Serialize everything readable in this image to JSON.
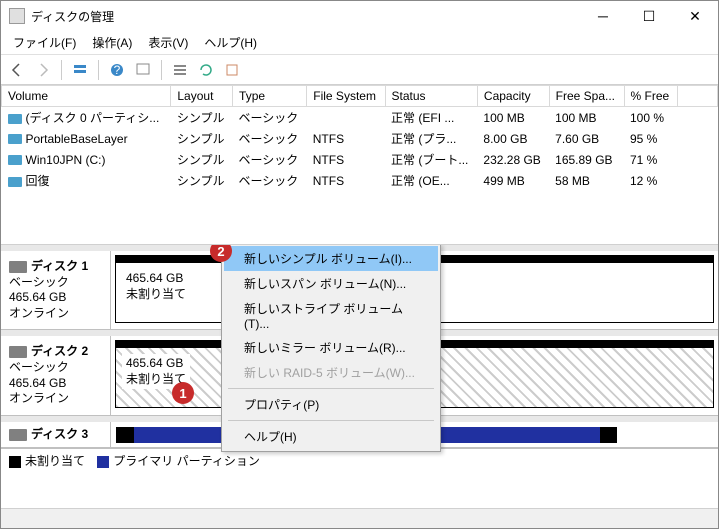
{
  "title": "ディスクの管理",
  "menu": {
    "file": "ファイル(F)",
    "action": "操作(A)",
    "view": "表示(V)",
    "help": "ヘルプ(H)"
  },
  "columns": {
    "vol": "Volume",
    "layout": "Layout",
    "type": "Type",
    "fs": "File System",
    "status": "Status",
    "cap": "Capacity",
    "free": "Free Spa...",
    "pct": "% Free"
  },
  "vols": [
    {
      "name": "(ディスク 0 パーティシ...",
      "layout": "シンプル",
      "type": "ベーシック",
      "fs": "",
      "status": "正常 (EFI ...",
      "cap": "100 MB",
      "free": "100 MB",
      "pct": "100 %"
    },
    {
      "name": "PortableBaseLayer",
      "layout": "シンプル",
      "type": "ベーシック",
      "fs": "NTFS",
      "status": "正常 (プラ...",
      "cap": "8.00 GB",
      "free": "7.60 GB",
      "pct": "95 %"
    },
    {
      "name": "Win10JPN (C:)",
      "layout": "シンプル",
      "type": "ベーシック",
      "fs": "NTFS",
      "status": "正常 (ブート...",
      "cap": "232.28 GB",
      "free": "165.89 GB",
      "pct": "71 %"
    },
    {
      "name": "回復",
      "layout": "シンプル",
      "type": "ベーシック",
      "fs": "NTFS",
      "status": "正常 (OE...",
      "cap": "499 MB",
      "free": "58 MB",
      "pct": "12 %"
    }
  ],
  "disks": [
    {
      "name": "ディスク 1",
      "type": "ベーシック",
      "cap": "465.64 GB",
      "state": "オンライン",
      "part_cap": "465.64 GB",
      "part_status": "未割り当て"
    },
    {
      "name": "ディスク 2",
      "type": "ベーシック",
      "cap": "465.64 GB",
      "state": "オンライン",
      "part_cap": "465.64 GB",
      "part_status": "未割り当て"
    },
    {
      "name": "ディスク 3"
    }
  ],
  "ctx": {
    "simple": "新しいシンプル ボリューム(I)...",
    "span": "新しいスパン ボリューム(N)...",
    "stripe": "新しいストライプ ボリューム(T)...",
    "mirror": "新しいミラー ボリューム(R)...",
    "raid5": "新しい RAID-5 ボリューム(W)...",
    "prop": "プロパティ(P)",
    "help": "ヘルプ(H)"
  },
  "legend": {
    "unalloc": "未割り当て",
    "primary": "プライマリ パーティション"
  },
  "badge1": "1",
  "badge2": "2"
}
